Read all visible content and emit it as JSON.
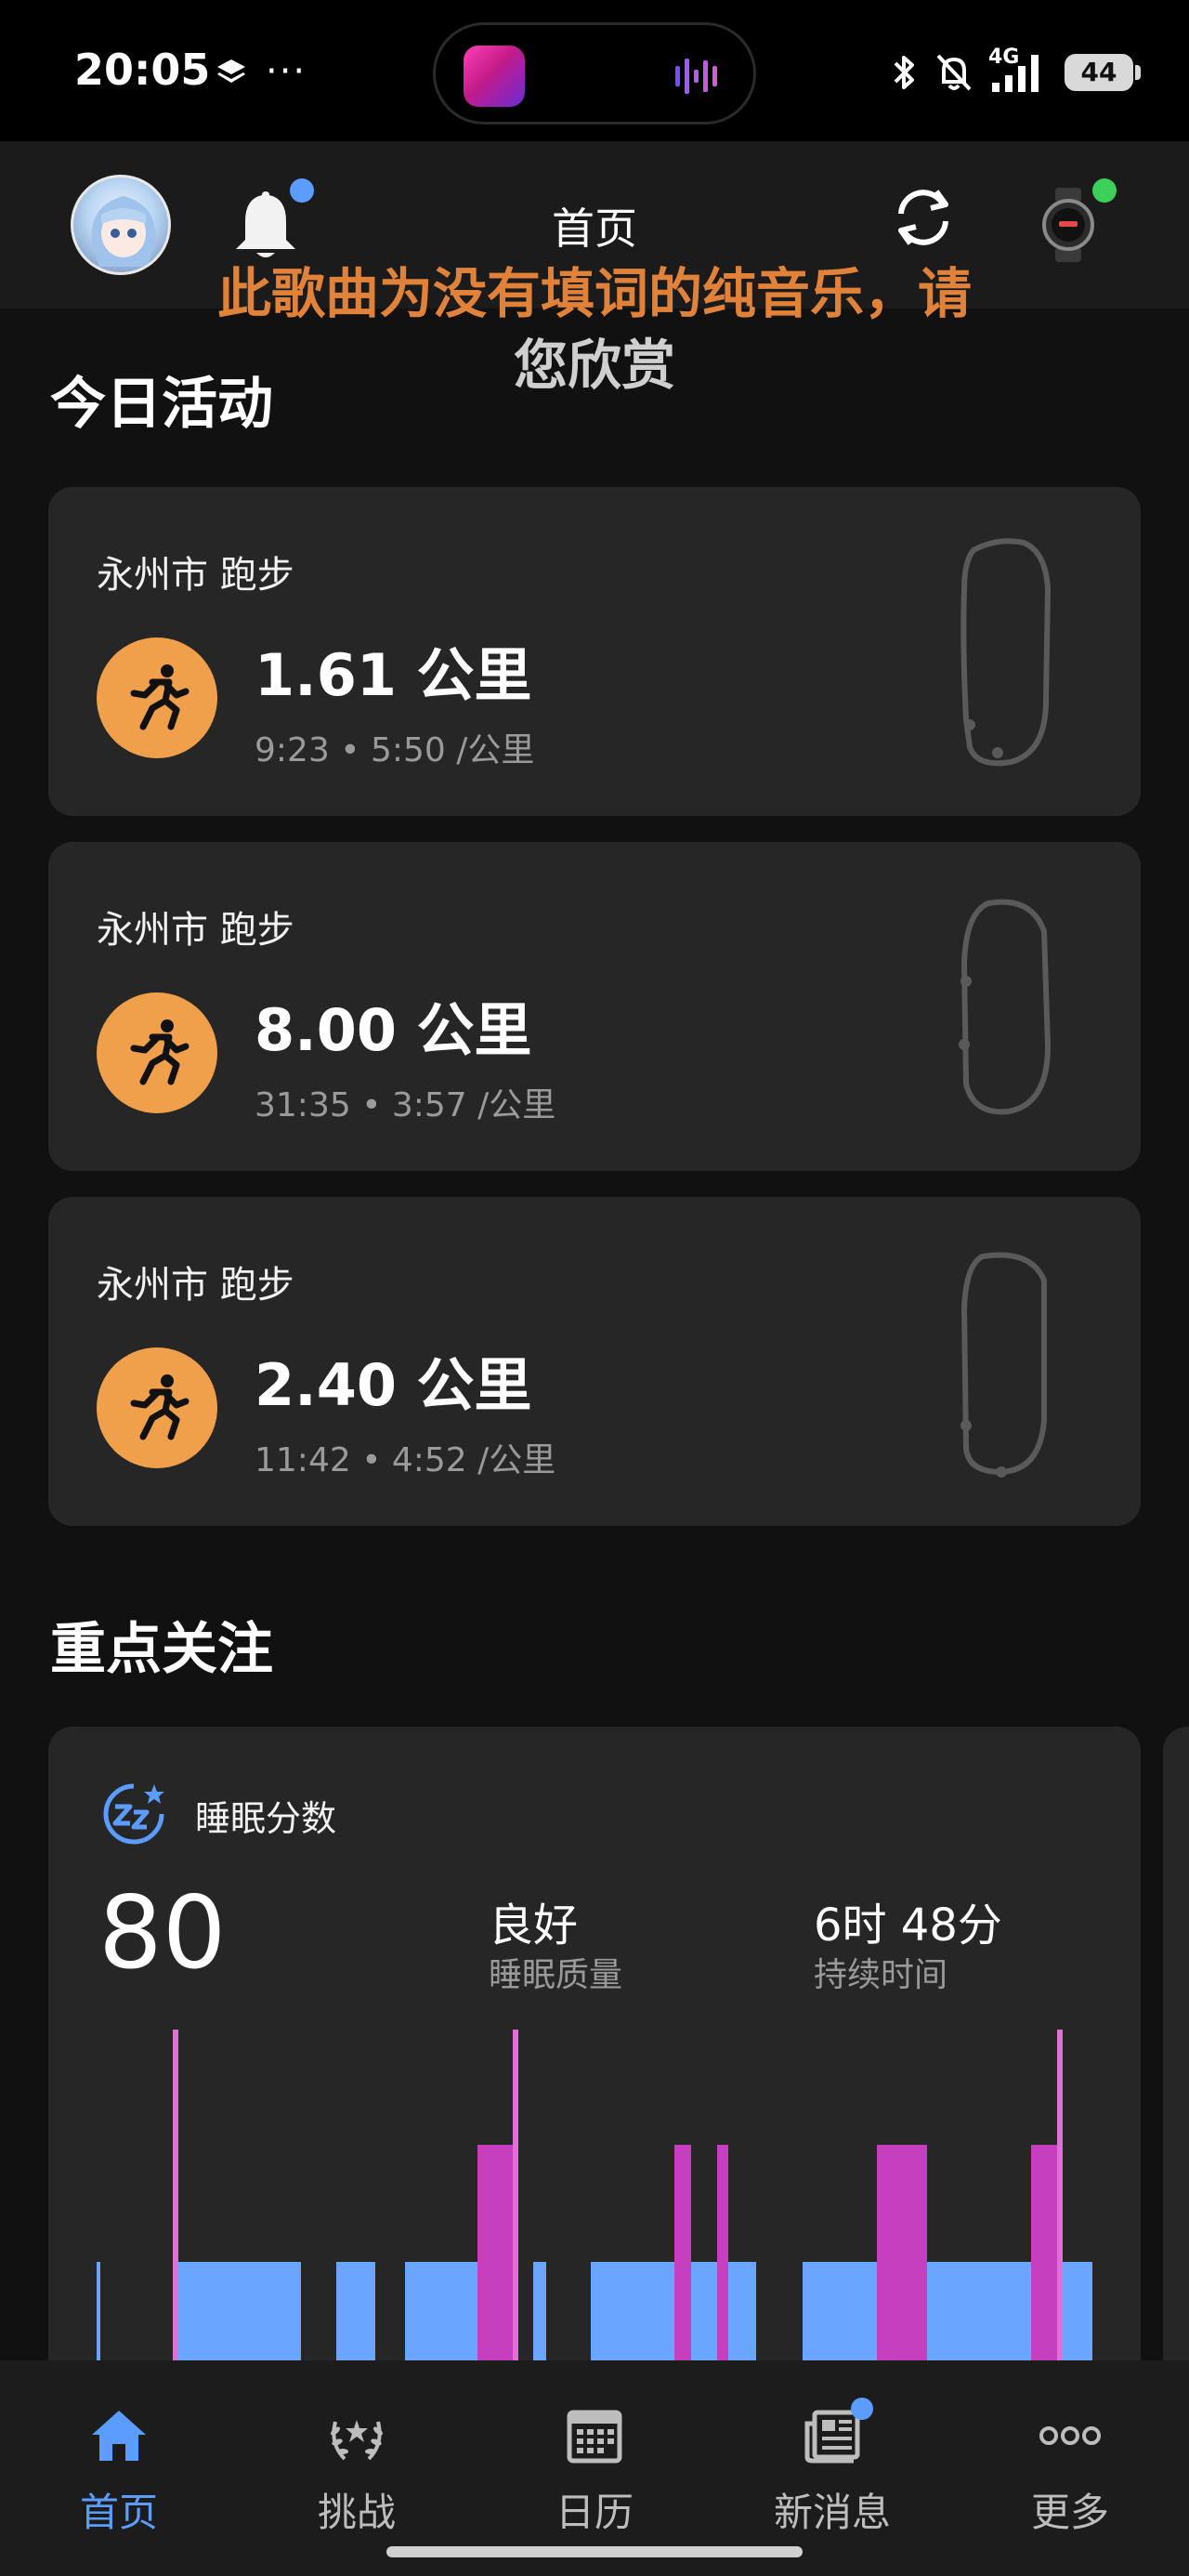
{
  "status_bar": {
    "time": "20:05",
    "more": "···",
    "network": "4G",
    "battery": "44"
  },
  "header": {
    "title": "首页"
  },
  "lyric": {
    "line1": "此歌曲为没有填词的纯音乐，请",
    "line2": "您欣赏"
  },
  "today": {
    "title": "今日活动",
    "activities": [
      {
        "location": "永州市 跑步",
        "distance": "1.61 公里",
        "meta": "9:23 • 5:50 /公里"
      },
      {
        "location": "永州市 跑步",
        "distance": "8.00 公里",
        "meta": "31:35 • 3:57 /公里"
      },
      {
        "location": "永州市 跑步",
        "distance": "2.40 公里",
        "meta": "11:42 • 4:52 /公里"
      }
    ]
  },
  "focus": {
    "title": "重点关注",
    "sleep": {
      "label": "睡眠分数",
      "score": "80",
      "quality_value": "良好",
      "quality_label": "睡眠质量",
      "duration_value": "6时 48分",
      "duration_label": "持续时间"
    }
  },
  "colors": {
    "accent": "#5b9cff",
    "run_badge": "#f0a04a",
    "sleep_light": "#6aa6ff",
    "sleep_rem": "#c63fbf",
    "sleep_awake": "#e070d8",
    "card": "#262626"
  },
  "nav": {
    "items": [
      {
        "label": "首页",
        "icon": "home-icon"
      },
      {
        "label": "挑战",
        "icon": "laurel-icon"
      },
      {
        "label": "日历",
        "icon": "calendar-icon"
      },
      {
        "label": "新消息",
        "icon": "newsfeed-icon"
      },
      {
        "label": "更多",
        "icon": "more-icon"
      }
    ]
  }
}
